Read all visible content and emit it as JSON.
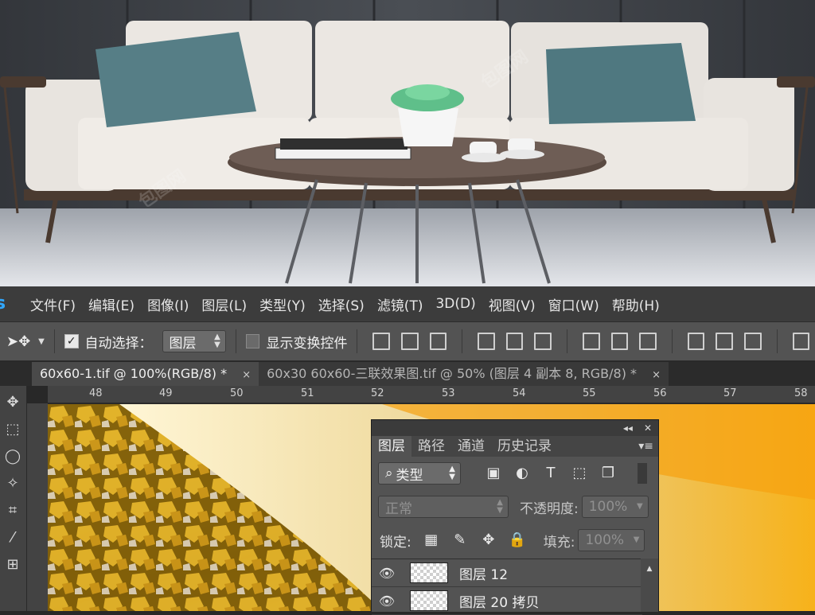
{
  "menubar": {
    "logo": "s",
    "items": [
      "文件(F)",
      "编辑(E)",
      "图像(I)",
      "图层(L)",
      "类型(Y)",
      "选择(S)",
      "滤镜(T)",
      "3D(D)",
      "视图(V)",
      "窗口(W)",
      "帮助(H)"
    ]
  },
  "options": {
    "auto_select_label": "自动选择：",
    "auto_select_checked": true,
    "auto_select_target": "图层",
    "show_transform_label": "显示变换控件",
    "show_transform_checked": false
  },
  "tabs": [
    {
      "label": "60x60-1.tif @ 100%(RGB/8) *",
      "close": "×",
      "active": true
    },
    {
      "label": "60x30 60x60-三联效果图.tif @ 50% (图层 4 副本 8, RGB/8) *",
      "close": "×",
      "active": false
    }
  ],
  "ruler": {
    "labels": [
      "48",
      "49",
      "50",
      "51",
      "52",
      "53",
      "54",
      "55",
      "56",
      "57",
      "58"
    ]
  },
  "layers_panel": {
    "tabs": [
      "图层",
      "路径",
      "通道",
      "历史记录"
    ],
    "active_tab": "图层",
    "filter": {
      "label": "类型"
    },
    "blend_mode": "正常",
    "opacity": {
      "label": "不透明度:",
      "value": "100%"
    },
    "lock": {
      "label": "锁定:"
    },
    "fill": {
      "label": "填充:",
      "value": "100%"
    },
    "layers": [
      {
        "name": "图层 12",
        "visible": true
      },
      {
        "name": "图层 20 拷贝",
        "visible": true
      }
    ]
  },
  "colors": {
    "app_accent": "#31a8ff",
    "menu_bg": "#3c3c3c",
    "panel_bg": "#535353",
    "canvas_gold": "#d6a21a"
  },
  "watermark": "包图网"
}
